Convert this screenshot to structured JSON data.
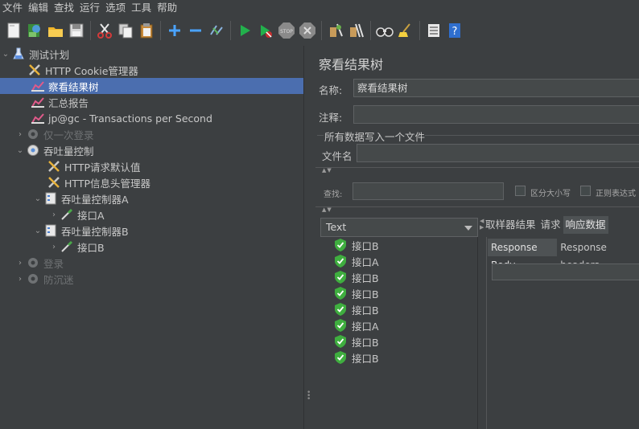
{
  "menu": [
    "文件",
    "编辑",
    "查找",
    "运行",
    "选项",
    "工具",
    "帮助"
  ],
  "tree": {
    "root": "测试计划",
    "items": [
      {
        "label": "HTTP Cookie管理器"
      },
      {
        "label": "察看结果树"
      },
      {
        "label": "汇总报告"
      },
      {
        "label": "jp@gc - Transactions per Second"
      },
      {
        "label": "仅一次登录"
      },
      {
        "label": "吞吐量控制"
      },
      {
        "label": "HTTP请求默认值"
      },
      {
        "label": "HTTP信息头管理器"
      },
      {
        "label": "吞吐量控制器A"
      },
      {
        "label": "接口A"
      },
      {
        "label": "吞吐量控制器B"
      },
      {
        "label": "接口B"
      },
      {
        "label": "登录"
      },
      {
        "label": "防沉迷"
      }
    ]
  },
  "panel": {
    "title": "察看结果树",
    "name_label": "名称:",
    "name_value": "察看结果树",
    "comment_label": "注释:",
    "write_all_label": "所有数据写入一个文件",
    "filename_label": "文件名",
    "search_label": "查找:",
    "case_label": "区分大小写",
    "regex_label": "正则表达式",
    "renderer_value": "Text"
  },
  "results": [
    "接口B",
    "接口A",
    "接口B",
    "接口B",
    "接口B",
    "接口A",
    "接口B",
    "接口B"
  ],
  "tabs_top": [
    "取样器结果",
    "请求",
    "响应数据"
  ],
  "tabs_sub": [
    "Response Body",
    "Response headers"
  ],
  "colors": {
    "selection": "#4b6eaf",
    "background": "#3c3f41",
    "success": "#3fae3f"
  }
}
